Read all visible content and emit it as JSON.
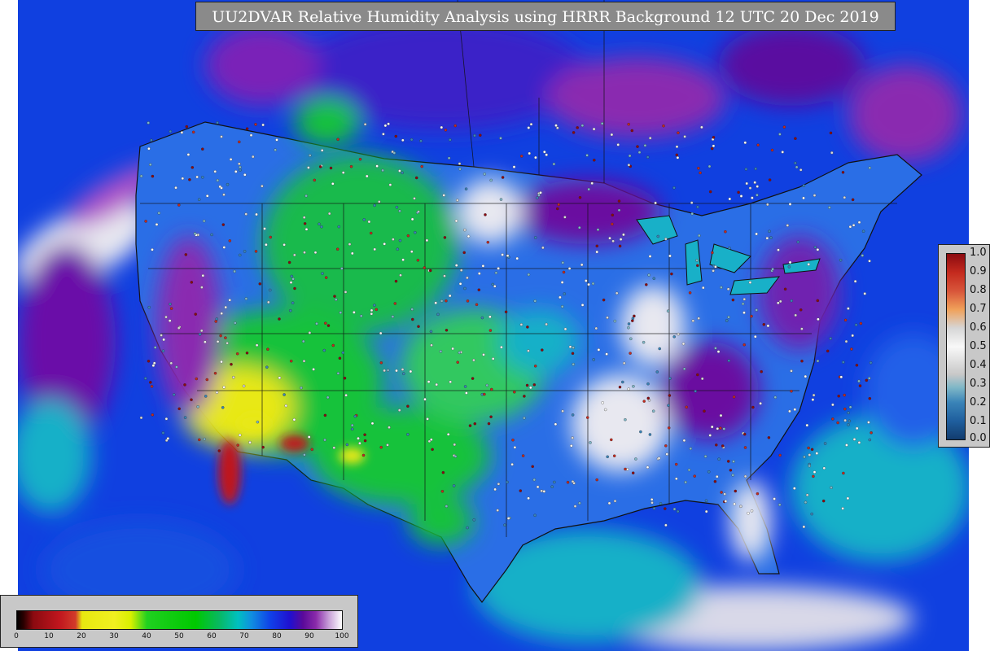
{
  "title": "UU2DVAR Relative Humidity Analysis using HRRR Background 12 UTC 20 Dec 2019",
  "obs_legend": {
    "ticks": [
      "1.0",
      "0.9",
      "0.8",
      "0.7",
      "0.6",
      "0.5",
      "0.4",
      "0.3",
      "0.2",
      "0.1",
      "0.0"
    ]
  },
  "rh_colorbar": {
    "ticks": [
      "0",
      "10",
      "20",
      "30",
      "40",
      "50",
      "60",
      "70",
      "80",
      "90",
      "100"
    ]
  },
  "colors": {
    "ocean": "#1040e0",
    "land_moist": "#2a6ee6",
    "land_green": "#18c23a",
    "land_dry_yellow": "#e8e818",
    "dry_red": "#c0161e",
    "humid_purple": "#6a0aa0",
    "saturated_white": "#ececec",
    "cyan_band": "#18b0c8",
    "title_bg": "#8a8a8a",
    "panel_bg": "#c8c8c8"
  }
}
